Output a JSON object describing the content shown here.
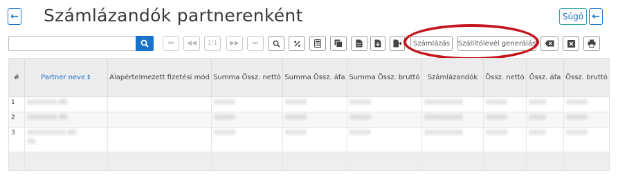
{
  "header": {
    "title": "Számlázandók partnerenként",
    "back_label": "←",
    "help_label": "Súgó"
  },
  "search": {
    "value": "",
    "placeholder": ""
  },
  "pager": {
    "page": "1/1"
  },
  "toolbar": {
    "invoice_label": "Számlázás",
    "delivery_note_label": "Szállítólevél generálás"
  },
  "table": {
    "columns": [
      "#",
      "Partner neve",
      "Alapértelmezett fizetési mód",
      "Summa Össz. nettó",
      "Summa Össz. áfa",
      "Summa Össz. bruttó",
      "Számlázandók",
      "Össz. nettó",
      "Össz. áfa",
      "Össz. bruttó"
    ],
    "sort_indicator": "⇕",
    "rows": [
      {
        "num": "1",
        "partner": "XXXXXXX Kft.",
        "payment": "",
        "sum_net": "XXXXX",
        "sum_vat": "XXXXX",
        "sum_gross": "XXXXX",
        "to_invoice": "XXXXXXXXX",
        "net": "XXXXX",
        "vat": "XXXX",
        "gross": "XXXXX"
      },
      {
        "num": "2",
        "partner": "XXXXXXX Kft.",
        "payment": "",
        "sum_net": "XXXXX",
        "sum_vat": "XXXXX",
        "sum_gross": "XXXXX",
        "to_invoice": "XXXXXXXXX",
        "net": "XXXXX",
        "vat": "XXXX",
        "gross": "XXXXX"
      },
      {
        "num": "3",
        "partner": "XXXXXXXXX Kft.",
        "partner_line2": "XX",
        "payment": "",
        "sum_net": "XXXXX",
        "sum_vat": "XXXXX",
        "sum_gross": "XXXXX",
        "to_invoice": "XXXXXXXXX",
        "net": "XXXXX",
        "vat": "XXXX",
        "gross": "XXXXX"
      }
    ]
  }
}
